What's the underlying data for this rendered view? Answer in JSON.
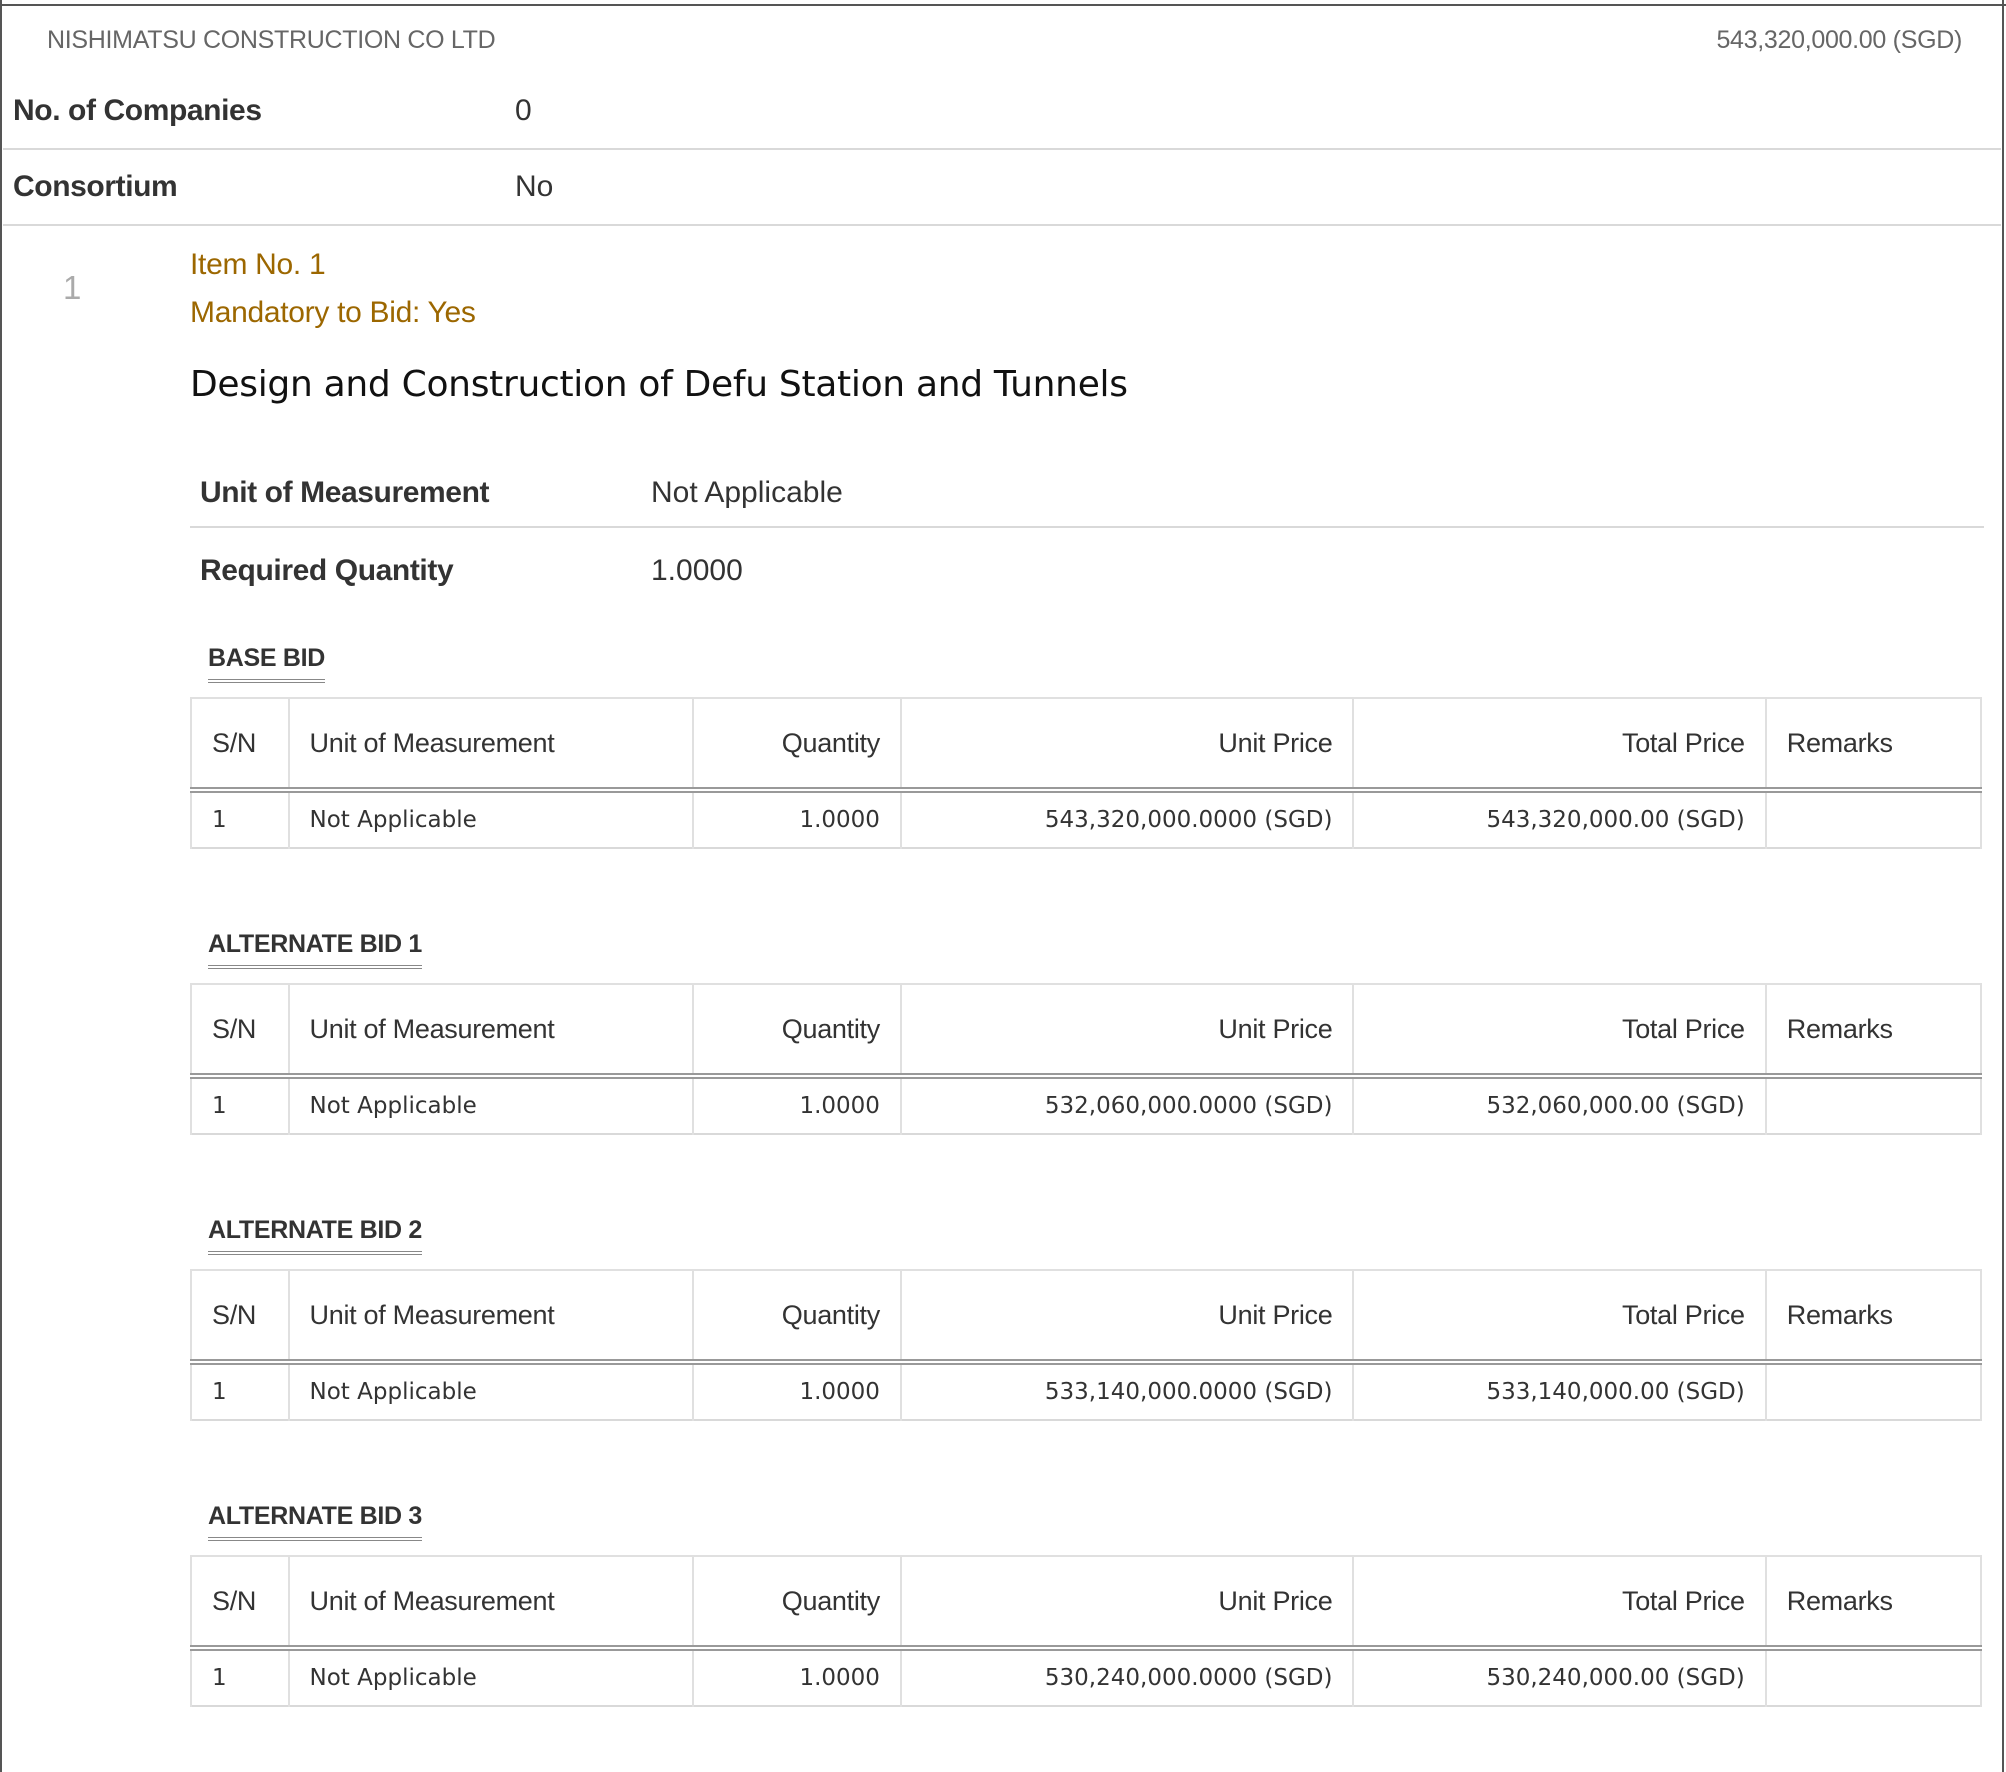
{
  "supplier": {
    "name": "NISHIMATSU CONSTRUCTION CO LTD",
    "amount": "543,320,000.00 (SGD)"
  },
  "info": [
    {
      "label": "No. of Companies",
      "value": "0"
    },
    {
      "label": "Consortium",
      "value": "No"
    }
  ],
  "item": {
    "index": "1",
    "item_no": "Item No. 1",
    "mandatory": "Mandatory to Bid: Yes",
    "title": "Design and Construction of Defu Station and Tunnels",
    "unit_label": "Unit of Measurement",
    "unit_value": "Not Applicable",
    "qty_label": "Required Quantity",
    "qty_value": "1.0000"
  },
  "columns": [
    "S/N",
    "Unit of Measurement",
    "Quantity",
    "Unit Price",
    "Total Price",
    "Remarks"
  ],
  "bids": [
    {
      "heading": "BASE BID",
      "row": {
        "sn": "1",
        "uom": "Not Applicable",
        "qty": "1.0000",
        "unit_price": "543,320,000.0000 (SGD)",
        "total_price": "543,320,000.00 (SGD)",
        "remarks": ""
      }
    },
    {
      "heading": "ALTERNATE BID 1",
      "row": {
        "sn": "1",
        "uom": "Not Applicable",
        "qty": "1.0000",
        "unit_price": "532,060,000.0000 (SGD)",
        "total_price": "532,060,000.00 (SGD)",
        "remarks": ""
      }
    },
    {
      "heading": "ALTERNATE BID 2",
      "row": {
        "sn": "1",
        "uom": "Not Applicable",
        "qty": "1.0000",
        "unit_price": "533,140,000.0000 (SGD)",
        "total_price": "533,140,000.00 (SGD)",
        "remarks": ""
      }
    },
    {
      "heading": "ALTERNATE BID 3",
      "row": {
        "sn": "1",
        "uom": "Not Applicable",
        "qty": "1.0000",
        "unit_price": "530,240,000.0000 (SGD)",
        "total_price": "530,240,000.00 (SGD)",
        "remarks": ""
      }
    }
  ]
}
